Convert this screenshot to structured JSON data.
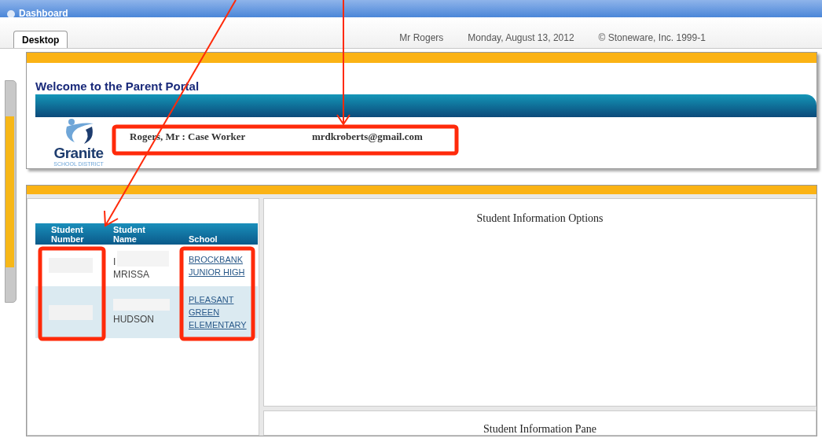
{
  "window": {
    "title": "Dashboard"
  },
  "tabs": [
    {
      "label": "Desktop",
      "selected": true
    }
  ],
  "header_info": [
    "Mr Rogers",
    "Monday, August 13, 2012",
    "© Stoneware, Inc. 1999-1"
  ],
  "welcome": {
    "title": "Welcome to the Parent Portal",
    "logo_name": "Granite",
    "logo_sub": "SCHOOL DISTRICT",
    "user": "Rogers, Mr : Case Worker",
    "email": "mrdkroberts@gmail.com"
  },
  "students": {
    "columns": [
      "Student Number",
      "Student Name",
      "School"
    ],
    "rows": [
      {
        "name_lines": [
          "I",
          "MRISSA"
        ],
        "school": [
          "BROCKBANK",
          "JUNIOR HIGH"
        ]
      },
      {
        "name_lines": [
          "HUDSON"
        ],
        "school": [
          "PLEASANT",
          "GREEN",
          "ELEMENTARY"
        ]
      }
    ]
  },
  "options_title": "Student Information Options",
  "pane_title": "Student Information Pane"
}
